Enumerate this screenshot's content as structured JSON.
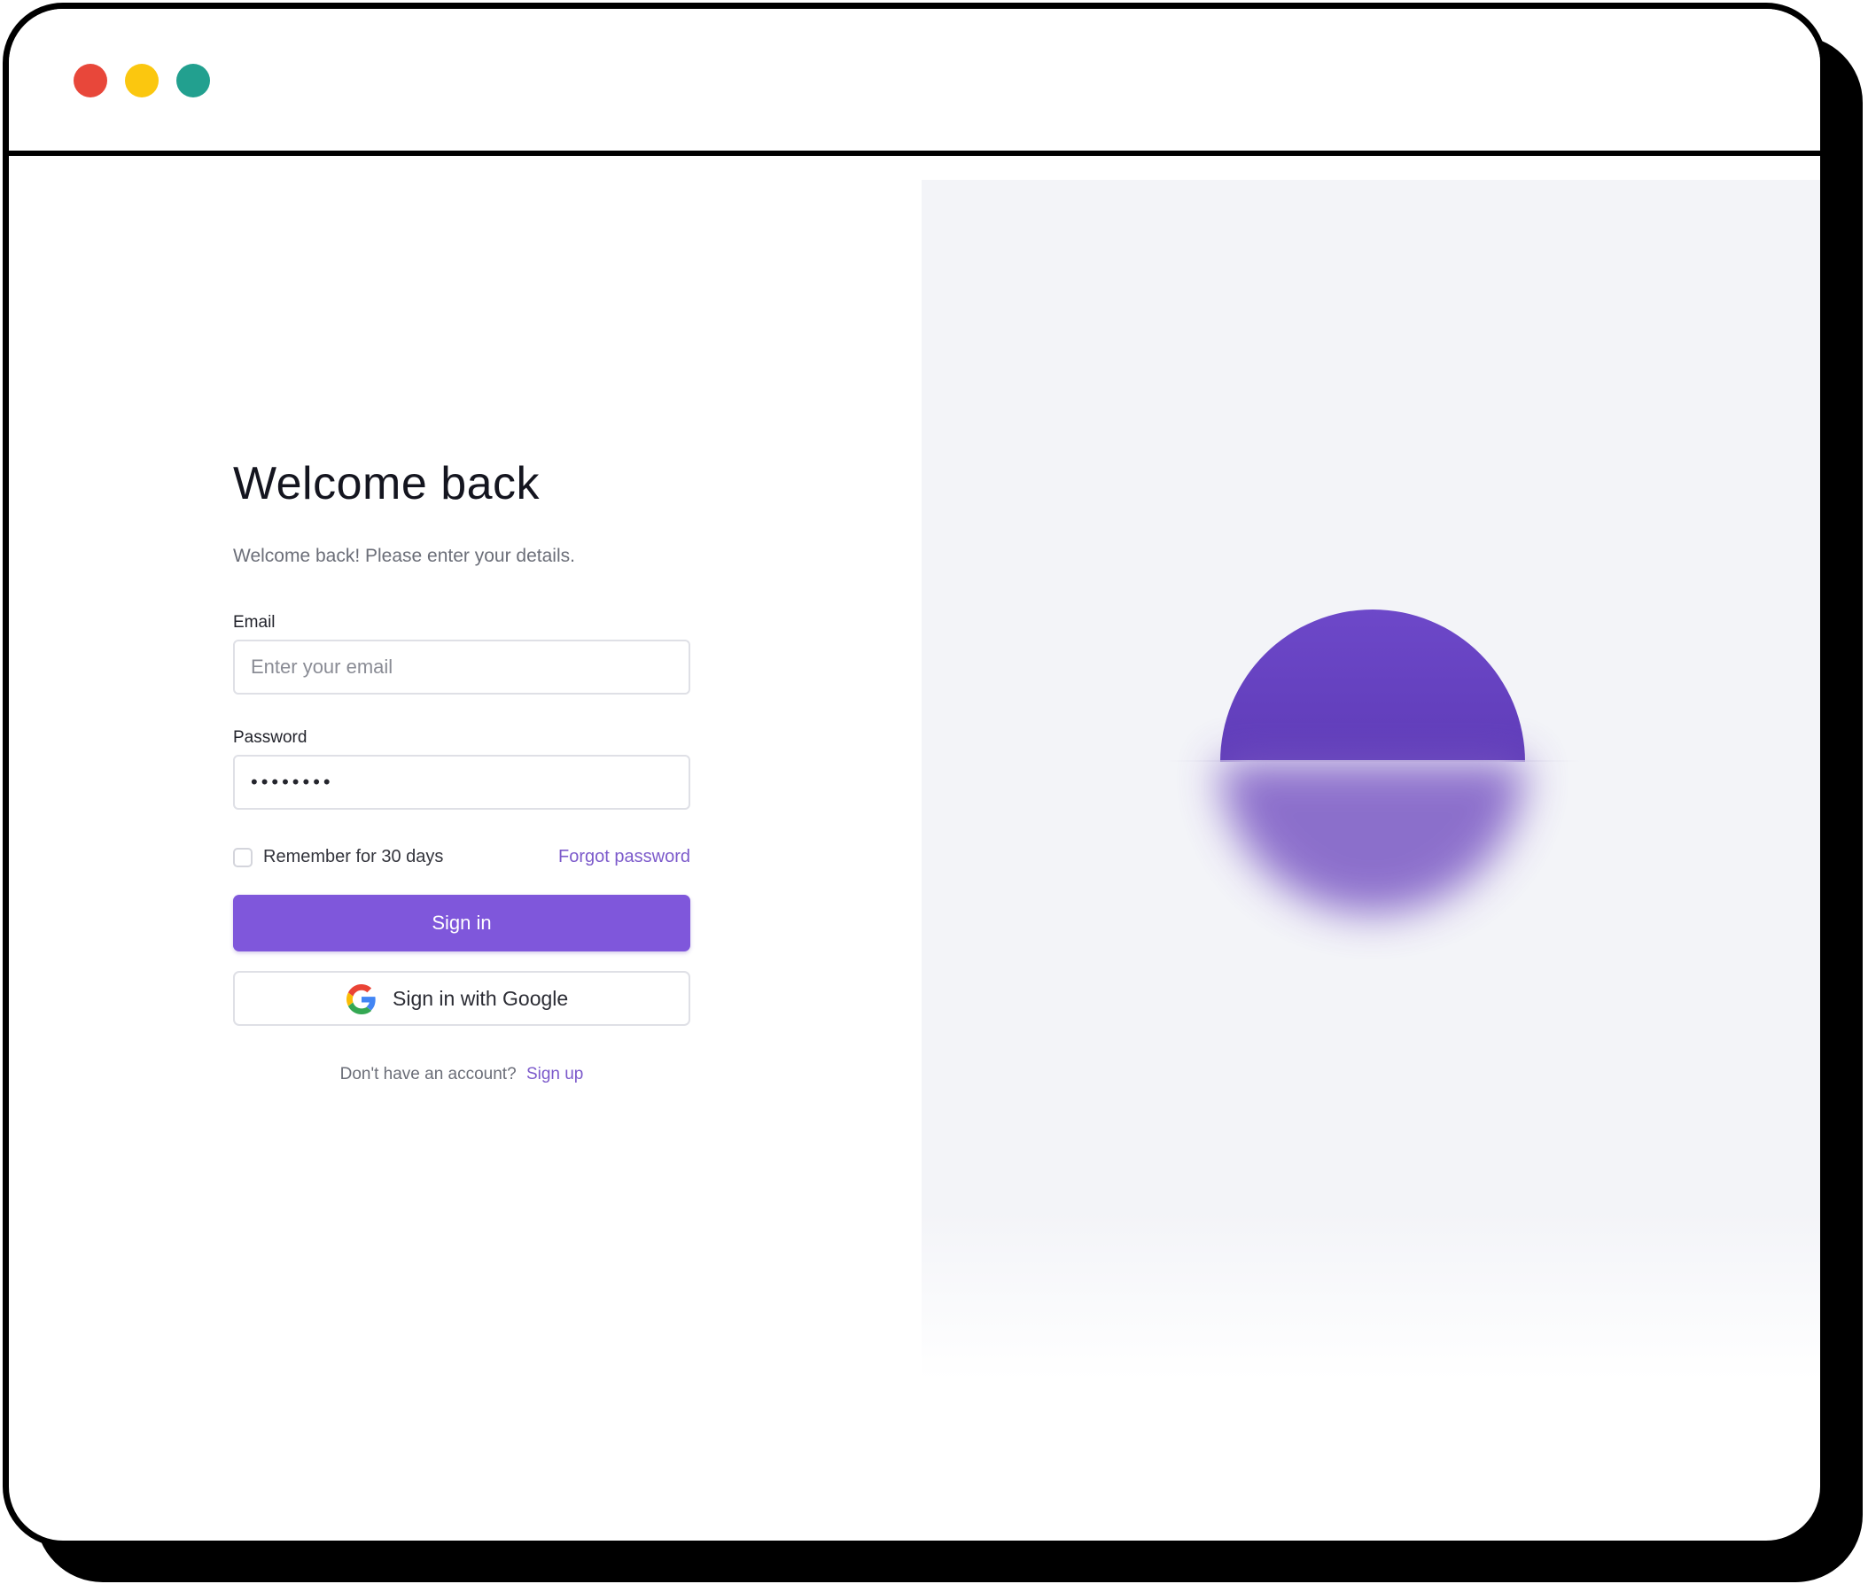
{
  "window": {
    "controls": [
      {
        "name": "close",
        "color": "#e8473a"
      },
      {
        "name": "minimize",
        "color": "#fbc70f"
      },
      {
        "name": "maximize",
        "color": "#22a08f"
      }
    ]
  },
  "login": {
    "title": "Welcome back",
    "subtitle": "Welcome back! Please enter your details.",
    "email": {
      "label": "Email",
      "placeholder": "Enter your email",
      "value": ""
    },
    "password": {
      "label": "Password",
      "value": "••••••••"
    },
    "remember": {
      "label": "Remember for 30 days",
      "checked": false
    },
    "forgot_label": "Forgot password",
    "signin_label": "Sign in",
    "google_label": "Sign in with Google",
    "signup_prompt": "Don't have an account?",
    "signup_label": "Sign up"
  },
  "colors": {
    "accent": "#7f57db",
    "link": "#7c5acb",
    "art_background": "#f3f4f8",
    "sun_top": "#6d48c9",
    "sun_bottom": "#5f3cb8",
    "reflection": "#7a58c4"
  },
  "icons": {
    "google": "google-g-icon",
    "checkbox": "checkbox-unchecked"
  }
}
